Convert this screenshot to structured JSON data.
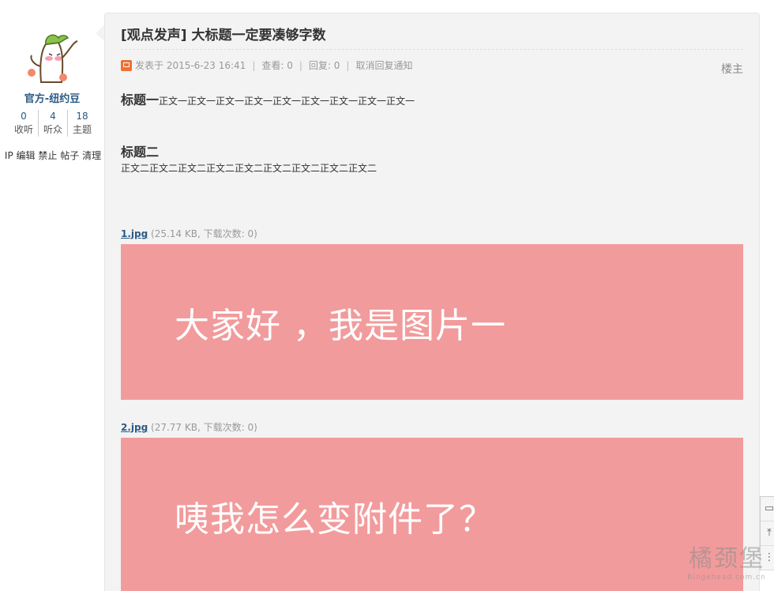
{
  "author": {
    "name": "官方-纽约豆",
    "stats": [
      {
        "value": "0",
        "label": "收听"
      },
      {
        "value": "4",
        "label": "听众"
      },
      {
        "value": "18",
        "label": "主题"
      }
    ],
    "admin_links": [
      "IP",
      "编辑",
      "禁止",
      "帖子",
      "清理"
    ]
  },
  "post": {
    "title": "[观点发声] 大标题一定要凑够字数",
    "meta": {
      "posted": "发表于 2015-6-23 16:41",
      "views": "查看: 0",
      "replies": "回复: 0",
      "cancel_notify": "取消回复通知"
    },
    "floor": "楼主",
    "heading1": "标题一",
    "body1": "正文一正文一正文一正文一正文一正文一正文一正文一正文一",
    "heading2": "标题二",
    "body2": "正文二正文二正文二正文二正文二正文二正文二正文二正文二",
    "attachments": [
      {
        "name": "1.jpg",
        "info": "(25.14 KB, 下载次数: 0)",
        "image_text": "大家好 ，我是图片一",
        "color": "#f29b9c"
      },
      {
        "name": "2.jpg",
        "info": "(27.77 KB, 下载次数: 0)",
        "image_text": "咦我怎么变附件了？",
        "color": "#f29b9c"
      }
    ]
  },
  "watermark": {
    "cn": "橘颈堡",
    "en": "Bingehead.com.cn"
  },
  "colors": {
    "link": "#2b5a85",
    "panel": "#f3f3f3",
    "attachment_bg": "#f29b9c"
  }
}
